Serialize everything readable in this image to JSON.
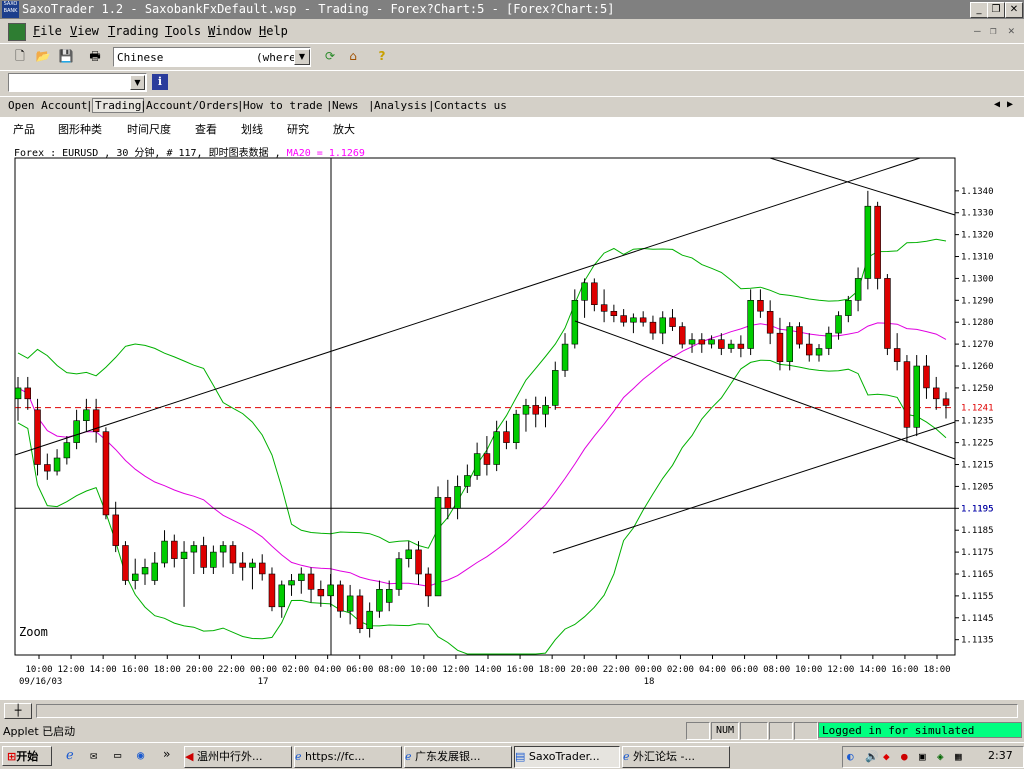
{
  "window": {
    "title": "SaxoTrader 1.2 - SaxobankFxDefault.wsp - Trading - Forex?Chart:5 - [Forex?Chart:5]",
    "logo_text": "SAXO BANK"
  },
  "menu": [
    {
      "label": "File",
      "key": "F"
    },
    {
      "label": "View",
      "key": "V"
    },
    {
      "label": "Trading",
      "key": "T"
    },
    {
      "label": "Tools",
      "key": "T"
    },
    {
      "label": "Window",
      "key": "W"
    },
    {
      "label": "Help",
      "key": "H"
    }
  ],
  "toolbar": {
    "language_value": "Chinese",
    "where_value": "(where",
    "icons": [
      "new-file-icon",
      "open-folder-icon",
      "save-icon",
      "print-icon",
      "refresh-icon",
      "home-icon",
      "help-icon"
    ]
  },
  "toolbar2": {
    "search_value": "",
    "info_icon": "info-icon"
  },
  "nav": {
    "items": [
      "Open Account",
      "Trading",
      "Account/Orders",
      "How to trade",
      "News",
      "Analysis",
      "Contacts us"
    ],
    "active": "Trading"
  },
  "chart_menu": [
    "产品",
    "图形种类",
    "时间尺度",
    "查看",
    "划线",
    "研究",
    "放大"
  ],
  "chart_header": {
    "info": "Forex : EURUSD , 30 分钟, # 117, 即时图表数据 ,",
    "ma_label": "MA20 = 1.1269",
    "ma_color": "#ff00ff"
  },
  "zoom_label": "Zoom",
  "chart_data": {
    "type": "candlestick",
    "symbol": "EURUSD",
    "interval": "30 分钟",
    "ylim": [
      1.1128,
      1.1355
    ],
    "y_ticks": [
      1.1135,
      1.1145,
      1.1155,
      1.1165,
      1.1175,
      1.1185,
      1.1195,
      1.1205,
      1.1215,
      1.1225,
      1.1235,
      1.125,
      1.126,
      1.127,
      1.128,
      1.129,
      1.13,
      1.131,
      1.132,
      1.133,
      1.134
    ],
    "y_tick_labels": [
      "1.1135",
      "1.1145",
      "1.1155",
      "1.1165",
      "1.1175",
      "1.1185",
      "1.1195",
      "1.1205",
      "1.1215",
      "1.1225",
      "1.1235",
      "1.1250",
      "1.1260",
      "1.1270",
      "1.1280",
      "1.1290",
      "1.1300",
      "1.1310",
      "1.1320",
      "1.1330",
      "1.1340"
    ],
    "current_price": 1.1241,
    "current_price_label": "1.1241",
    "cursor_price": 1.1195,
    "cursor_price_label": "1.1195",
    "x_tick_labels": [
      "10:00",
      "12:00",
      "14:00",
      "16:00",
      "18:00",
      "20:00",
      "22:00",
      "00:00",
      "02:00",
      "04:00",
      "06:00",
      "08:00",
      "10:00",
      "12:00",
      "14:00",
      "16:00",
      "18:00",
      "20:00",
      "22:00",
      "00:00",
      "02:00",
      "04:00",
      "06:00",
      "08:00",
      "10:00",
      "12:00",
      "14:00",
      "16:00",
      "18:00"
    ],
    "date_labels": [
      "09/16/03",
      "17",
      "18"
    ],
    "candle_colors": {
      "up": "#00cc00",
      "down": "#dd0000"
    },
    "ma_color": "#e000e0",
    "band_color": "#00b000",
    "candles": [
      [
        1.1245,
        1.1255,
        1.1235,
        1.125
      ],
      [
        1.125,
        1.1255,
        1.124,
        1.1245
      ],
      [
        1.124,
        1.1245,
        1.121,
        1.1215
      ],
      [
        1.1215,
        1.122,
        1.1208,
        1.1212
      ],
      [
        1.1212,
        1.1222,
        1.121,
        1.1218
      ],
      [
        1.1218,
        1.1228,
        1.1215,
        1.1225
      ],
      [
        1.1225,
        1.124,
        1.1222,
        1.1235
      ],
      [
        1.1235,
        1.1245,
        1.123,
        1.124
      ],
      [
        1.124,
        1.1245,
        1.1225,
        1.123
      ],
      [
        1.123,
        1.1232,
        1.119,
        1.1192
      ],
      [
        1.1192,
        1.1198,
        1.1175,
        1.1178
      ],
      [
        1.1178,
        1.118,
        1.116,
        1.1162
      ],
      [
        1.1162,
        1.1172,
        1.1158,
        1.1165
      ],
      [
        1.1165,
        1.1172,
        1.116,
        1.1168
      ],
      [
        1.1162,
        1.1175,
        1.116,
        1.117
      ],
      [
        1.117,
        1.1185,
        1.1168,
        1.118
      ],
      [
        1.118,
        1.1183,
        1.1168,
        1.1172
      ],
      [
        1.1172,
        1.118,
        1.115,
        1.1175
      ],
      [
        1.1175,
        1.118,
        1.1165,
        1.1178
      ],
      [
        1.1178,
        1.1182,
        1.1165,
        1.1168
      ],
      [
        1.1168,
        1.1178,
        1.1165,
        1.1175
      ],
      [
        1.1175,
        1.118,
        1.1168,
        1.1178
      ],
      [
        1.1178,
        1.118,
        1.1165,
        1.117
      ],
      [
        1.117,
        1.1175,
        1.1162,
        1.1168
      ],
      [
        1.1168,
        1.1172,
        1.1158,
        1.117
      ],
      [
        1.117,
        1.1174,
        1.1162,
        1.1165
      ],
      [
        1.1165,
        1.1168,
        1.1148,
        1.115
      ],
      [
        1.115,
        1.1162,
        1.1145,
        1.116
      ],
      [
        1.116,
        1.1165,
        1.1155,
        1.1162
      ],
      [
        1.1162,
        1.1168,
        1.1156,
        1.1165
      ],
      [
        1.1165,
        1.1168,
        1.1152,
        1.1158
      ],
      [
        1.1158,
        1.1162,
        1.115,
        1.1155
      ],
      [
        1.1155,
        1.1165,
        1.115,
        1.116
      ],
      [
        1.116,
        1.1162,
        1.1145,
        1.1148
      ],
      [
        1.1148,
        1.116,
        1.1142,
        1.1155
      ],
      [
        1.1155,
        1.1158,
        1.1138,
        1.114
      ],
      [
        1.114,
        1.1152,
        1.1136,
        1.1148
      ],
      [
        1.1148,
        1.1162,
        1.1145,
        1.1158
      ],
      [
        1.1152,
        1.1162,
        1.1148,
        1.1158
      ],
      [
        1.1158,
        1.1175,
        1.1155,
        1.1172
      ],
      [
        1.1172,
        1.118,
        1.1168,
        1.1176
      ],
      [
        1.1176,
        1.118,
        1.116,
        1.1165
      ],
      [
        1.1165,
        1.1168,
        1.115,
        1.1155
      ],
      [
        1.1155,
        1.1205,
        1.1155,
        1.12
      ],
      [
        1.12,
        1.1208,
        1.119,
        1.1195
      ],
      [
        1.1195,
        1.121,
        1.119,
        1.1205
      ],
      [
        1.1205,
        1.1215,
        1.1202,
        1.121
      ],
      [
        1.121,
        1.1225,
        1.1208,
        1.122
      ],
      [
        1.122,
        1.1228,
        1.121,
        1.1215
      ],
      [
        1.1215,
        1.1235,
        1.1212,
        1.123
      ],
      [
        1.123,
        1.1235,
        1.1222,
        1.1225
      ],
      [
        1.1225,
        1.124,
        1.1222,
        1.1238
      ],
      [
        1.1238,
        1.1245,
        1.123,
        1.1242
      ],
      [
        1.1242,
        1.1246,
        1.1232,
        1.1238
      ],
      [
        1.1238,
        1.1246,
        1.1232,
        1.1242
      ],
      [
        1.1242,
        1.1262,
        1.124,
        1.1258
      ],
      [
        1.1258,
        1.1275,
        1.1255,
        1.127
      ],
      [
        1.127,
        1.1295,
        1.1268,
        1.129
      ],
      [
        1.129,
        1.13,
        1.1282,
        1.1298
      ],
      [
        1.1298,
        1.13,
        1.1285,
        1.1288
      ],
      [
        1.1288,
        1.1295,
        1.128,
        1.1285
      ],
      [
        1.1285,
        1.1288,
        1.128,
        1.1283
      ],
      [
        1.1283,
        1.1286,
        1.1278,
        1.128
      ],
      [
        1.128,
        1.1284,
        1.1275,
        1.1282
      ],
      [
        1.1282,
        1.1285,
        1.1278,
        1.128
      ],
      [
        1.128,
        1.1283,
        1.1272,
        1.1275
      ],
      [
        1.1275,
        1.1285,
        1.127,
        1.1282
      ],
      [
        1.1282,
        1.1286,
        1.1276,
        1.1278
      ],
      [
        1.1278,
        1.128,
        1.1268,
        1.127
      ],
      [
        1.127,
        1.1275,
        1.1266,
        1.1272
      ],
      [
        1.1272,
        1.1275,
        1.1266,
        1.127
      ],
      [
        1.127,
        1.1274,
        1.1268,
        1.1272
      ],
      [
        1.1272,
        1.1275,
        1.1265,
        1.1268
      ],
      [
        1.1268,
        1.1272,
        1.1266,
        1.127
      ],
      [
        1.127,
        1.1274,
        1.1264,
        1.1268
      ],
      [
        1.1268,
        1.1295,
        1.1265,
        1.129
      ],
      [
        1.129,
        1.1295,
        1.1282,
        1.1285
      ],
      [
        1.1285,
        1.129,
        1.127,
        1.1275
      ],
      [
        1.1275,
        1.1282,
        1.1258,
        1.1262
      ],
      [
        1.1262,
        1.128,
        1.1258,
        1.1278
      ],
      [
        1.1278,
        1.128,
        1.1268,
        1.127
      ],
      [
        1.127,
        1.1275,
        1.1262,
        1.1265
      ],
      [
        1.1265,
        1.127,
        1.1262,
        1.1268
      ],
      [
        1.1268,
        1.1278,
        1.1265,
        1.1275
      ],
      [
        1.1275,
        1.1285,
        1.1272,
        1.1283
      ],
      [
        1.1283,
        1.1292,
        1.128,
        1.129
      ],
      [
        1.129,
        1.1305,
        1.1285,
        1.13
      ],
      [
        1.13,
        1.134,
        1.1295,
        1.1333
      ],
      [
        1.1333,
        1.1335,
        1.1295,
        1.13
      ],
      [
        1.13,
        1.1302,
        1.1265,
        1.1268
      ],
      [
        1.1268,
        1.1275,
        1.1258,
        1.1262
      ],
      [
        1.1262,
        1.1265,
        1.1225,
        1.1232
      ],
      [
        1.1232,
        1.1265,
        1.1228,
        1.126
      ],
      [
        1.126,
        1.1265,
        1.1245,
        1.125
      ],
      [
        1.125,
        1.1255,
        1.124,
        1.1245
      ],
      [
        1.1245,
        1.1248,
        1.1236,
        1.1242
      ]
    ]
  },
  "status": {
    "left": "Applet 已启动",
    "num": "NUM",
    "login": "Logged in for simulated trading"
  },
  "taskbar": {
    "start": "开始",
    "items": [
      "温州中行外...",
      "https://fc...",
      "广东发展银...",
      "SaxoTrader...",
      "外汇论坛 -..."
    ],
    "active_index": 3,
    "clock": "2:37"
  }
}
